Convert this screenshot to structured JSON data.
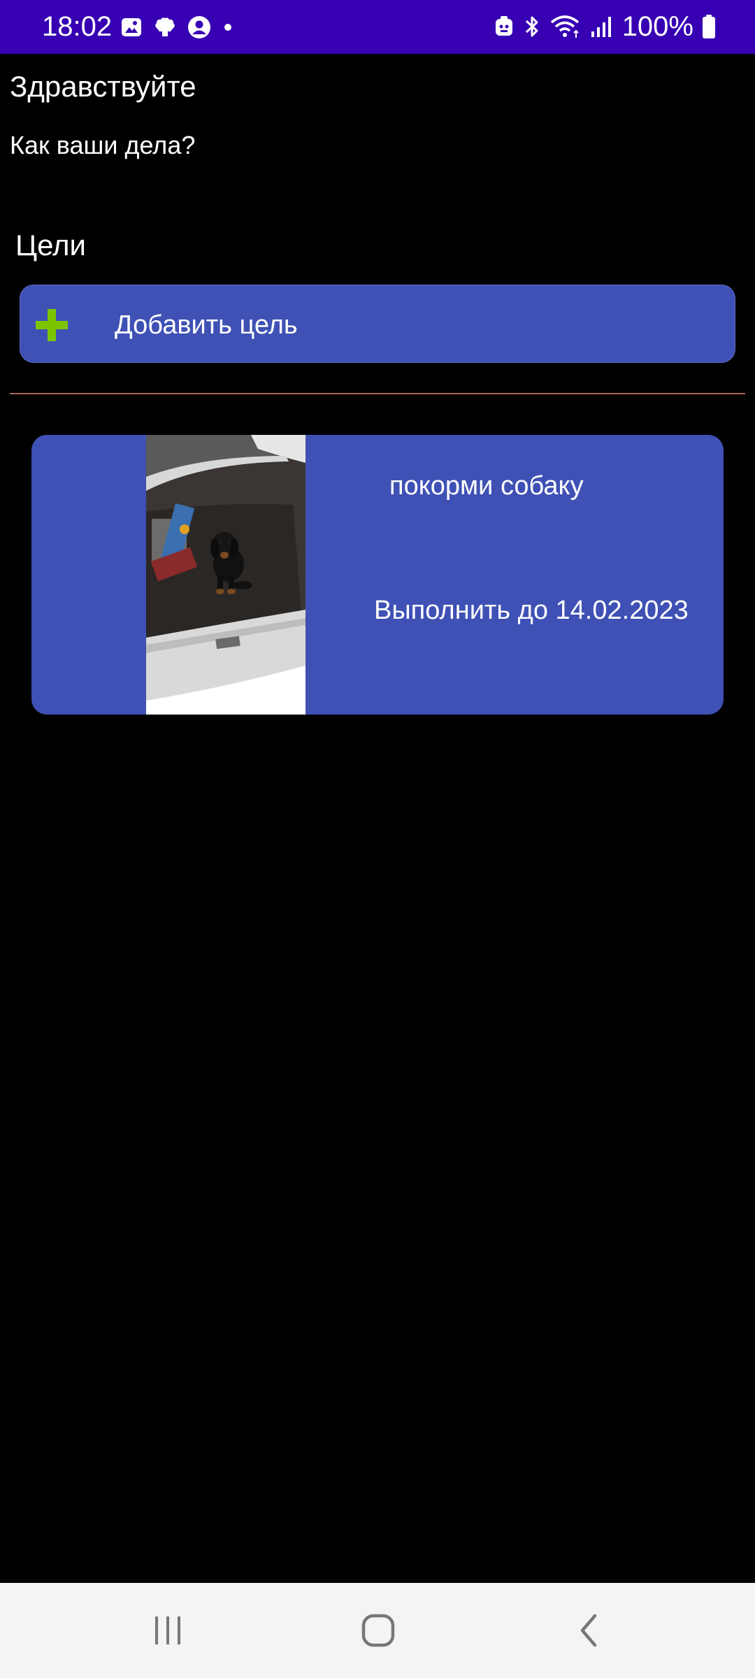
{
  "status_bar": {
    "time": "18:02",
    "battery": "100%",
    "left_icons": [
      "gallery-icon",
      "app-icon",
      "account-icon",
      "notification-dot-icon"
    ],
    "right_icons": [
      "dnd-icon",
      "bluetooth-icon",
      "wifi-icon",
      "signal-icon",
      "battery-icon"
    ],
    "background_color": "#3700b3"
  },
  "greeting": {
    "title": "Здравствуйте",
    "subtitle": "Как ваши дела?"
  },
  "goals": {
    "section_title": "Цели",
    "add_button_label": "Добавить цель",
    "add_button_icon": "plus-icon",
    "items": [
      {
        "title": "покорми собаку",
        "deadline": "Выполнить до 14.02.2023",
        "photo": "dog-in-car-trunk"
      }
    ]
  },
  "colors": {
    "accent": "#3f51b5",
    "plus": "#7cc400",
    "divider": "#b0665a"
  },
  "nav_bar": {
    "buttons": [
      "recents-icon",
      "home-icon",
      "back-icon"
    ]
  }
}
